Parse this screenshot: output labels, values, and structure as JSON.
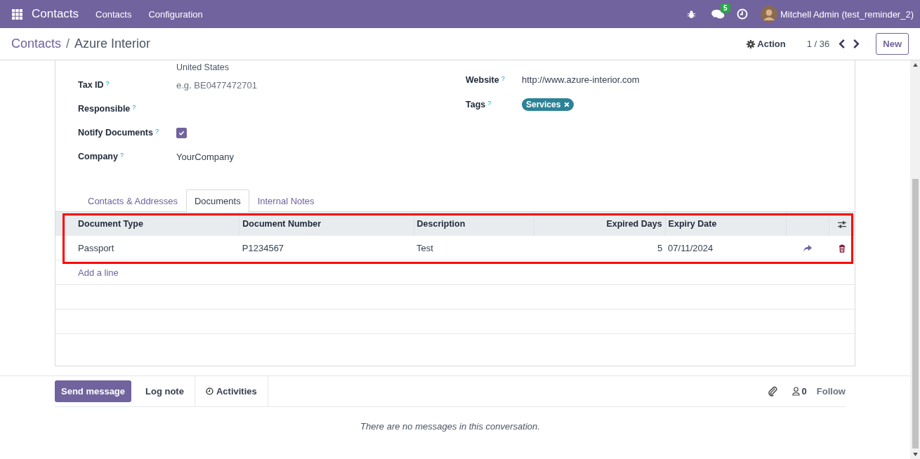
{
  "navbar": {
    "app": "Contacts",
    "menus": [
      "Contacts",
      "Configuration"
    ],
    "messages_badge": "5",
    "user": "Mitchell Admin (test_reminder_2)"
  },
  "breadcrumb": {
    "parent": "Contacts",
    "separator": "/",
    "current": "Azure Interior"
  },
  "control": {
    "action": "Action",
    "pager": "1 / 36",
    "new_button": "New"
  },
  "form": {
    "address_tail": "United States",
    "left_fields": [
      {
        "label": "Tax ID",
        "help": "?",
        "kind": "text",
        "placeholder": "e.g. BE0477472701"
      },
      {
        "label": "Responsible",
        "help": "?",
        "kind": "text"
      },
      {
        "label": "Notify Documents",
        "help": "?",
        "kind": "checkbox",
        "checked": true
      },
      {
        "label": "Company",
        "help": "?",
        "kind": "text",
        "value": "YourCompany"
      }
    ],
    "right_fields": [
      {
        "label": "Website",
        "help": "?",
        "kind": "text",
        "value": "http://www.azure-interior.com"
      },
      {
        "label": "Tags",
        "help": "?",
        "kind": "tags",
        "tags": [
          {
            "label": "Services",
            "color": "#2c8397"
          }
        ]
      }
    ]
  },
  "tabs": [
    {
      "label": "Contacts & Addresses",
      "selected": false
    },
    {
      "label": "Documents",
      "selected": true
    },
    {
      "label": "Internal Notes",
      "selected": false
    }
  ],
  "table": {
    "columns": [
      {
        "label": "Document Type"
      },
      {
        "label": "Document Number"
      },
      {
        "label": "Description"
      },
      {
        "label": "Expired Days"
      },
      {
        "label": "Expiry Date"
      }
    ],
    "rows": [
      {
        "cells": [
          "Passport",
          "P1234567",
          "Test",
          "5",
          "07/11/2024"
        ]
      }
    ],
    "add_line": "Add a line"
  },
  "chatter": {
    "buttons": [
      {
        "label": "Send message",
        "kind": "primary"
      },
      {
        "label": "Log note",
        "kind": "tab"
      },
      {
        "label": "Activities",
        "kind": "activities"
      }
    ],
    "followers": "0",
    "follow": "Follow",
    "empty": "There are no messages in this conversation."
  }
}
